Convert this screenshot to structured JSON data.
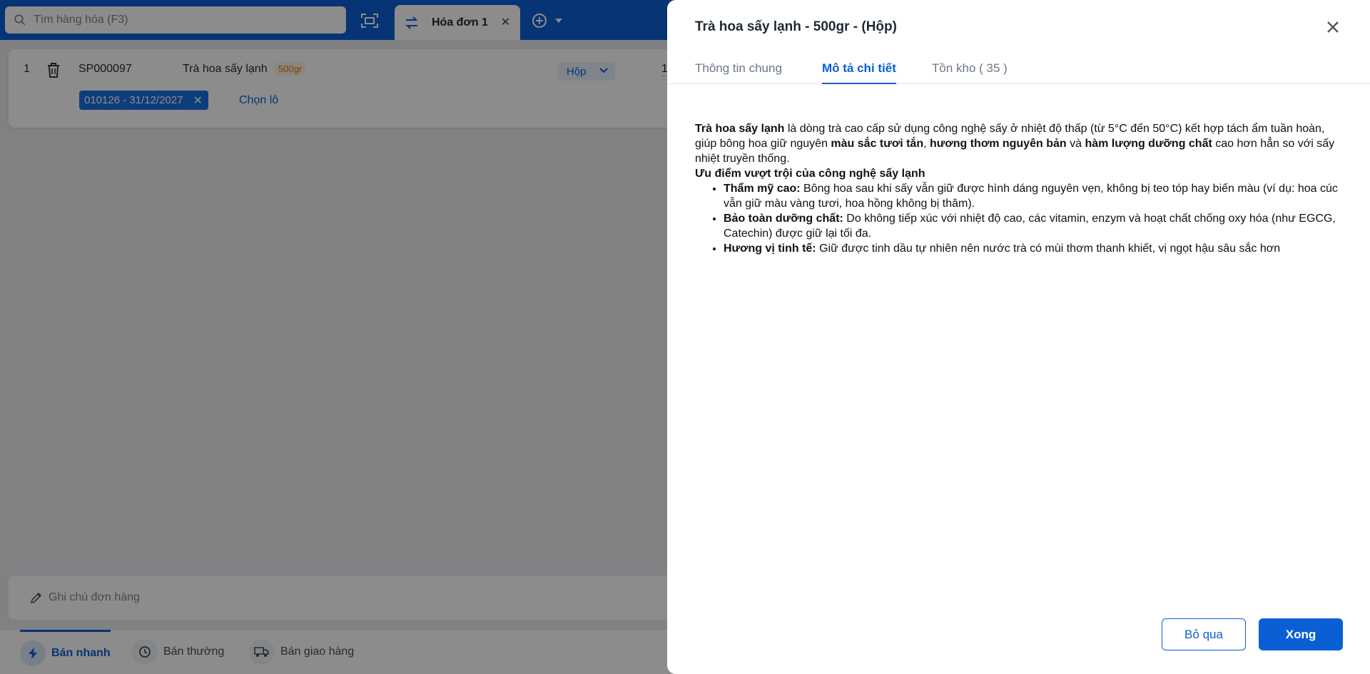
{
  "colors": {
    "primary": "#0b5fd4",
    "badge_orange": "#e07a00",
    "overlay": "rgba(0,0,0,0.45)"
  },
  "pos": {
    "search": {
      "placeholder": "Tìm hàng hóa (F3)",
      "icon": "search-icon"
    },
    "tab": {
      "label": "Hóa đơn 1"
    },
    "order_line": {
      "index": "1",
      "sku": "SP000097",
      "name": "Trà hoa sấy lạnh",
      "variant": "500gr",
      "unit": "Hộp",
      "quantity": "1",
      "lot": "010126 - 31/12/2027",
      "choose_lot": "Chọn lô"
    },
    "note": {
      "placeholder": "Ghi chú đơn hàng"
    },
    "modes": [
      {
        "label": "Bán nhanh",
        "icon": "lightning-icon",
        "active": true
      },
      {
        "label": "Bán thường",
        "icon": "clock-icon",
        "active": false
      },
      {
        "label": "Bán giao hàng",
        "icon": "truck-icon",
        "active": false
      }
    ]
  },
  "drawer": {
    "title": "Trà hoa sấy lạnh - 500gr - (Hộp)",
    "tabs": [
      {
        "label": "Thông tin chung",
        "active": false
      },
      {
        "label": "Mô tả chi tiết",
        "active": true
      },
      {
        "label": "Tồn kho ( 35 )",
        "active": false
      }
    ],
    "description": {
      "intro": {
        "lead_bold": "Trà hoa sấy lạnh",
        "part1": " là dòng trà cao cấp sử dụng công nghệ sấy ở nhiệt độ thấp (từ 5°C đến 50°C) kết hợp tách ẩm tuần hoàn, giúp bông hoa giữ nguyên ",
        "bold1": "màu sắc tươi tắn",
        "part2": ", ",
        "bold2": "hương thơm nguyên bản",
        "part3": " và ",
        "bold3": "hàm lượng dưỡng chất",
        "part4": " cao hơn hẳn so với sấy nhiệt truyền thống."
      },
      "heading": "Ưu điểm vượt trội của công nghệ sấy lạnh",
      "bullets": [
        {
          "label": "Thẩm mỹ cao:",
          "text": " Bông hoa sau khi sấy vẫn giữ được hình dáng nguyên vẹn, không bị teo tóp hay biến màu (ví dụ: hoa cúc vẫn giữ màu vàng tươi, hoa hồng không bị thâm)."
        },
        {
          "label": "Bảo toàn dưỡng chất:",
          "text": " Do không tiếp xúc với nhiệt độ cao, các vitamin, enzym và hoạt chất chống oxy hóa (như EGCG, Catechin) được giữ lại tối đa."
        },
        {
          "label": "Hương vị tinh tế:",
          "text": " Giữ được tinh dầu tự nhiên nên nước trà có mùi thơm thanh khiết, vị ngọt hậu sâu sắc hơn"
        }
      ]
    },
    "buttons": {
      "cancel": "Bỏ qua",
      "done": "Xong"
    }
  }
}
